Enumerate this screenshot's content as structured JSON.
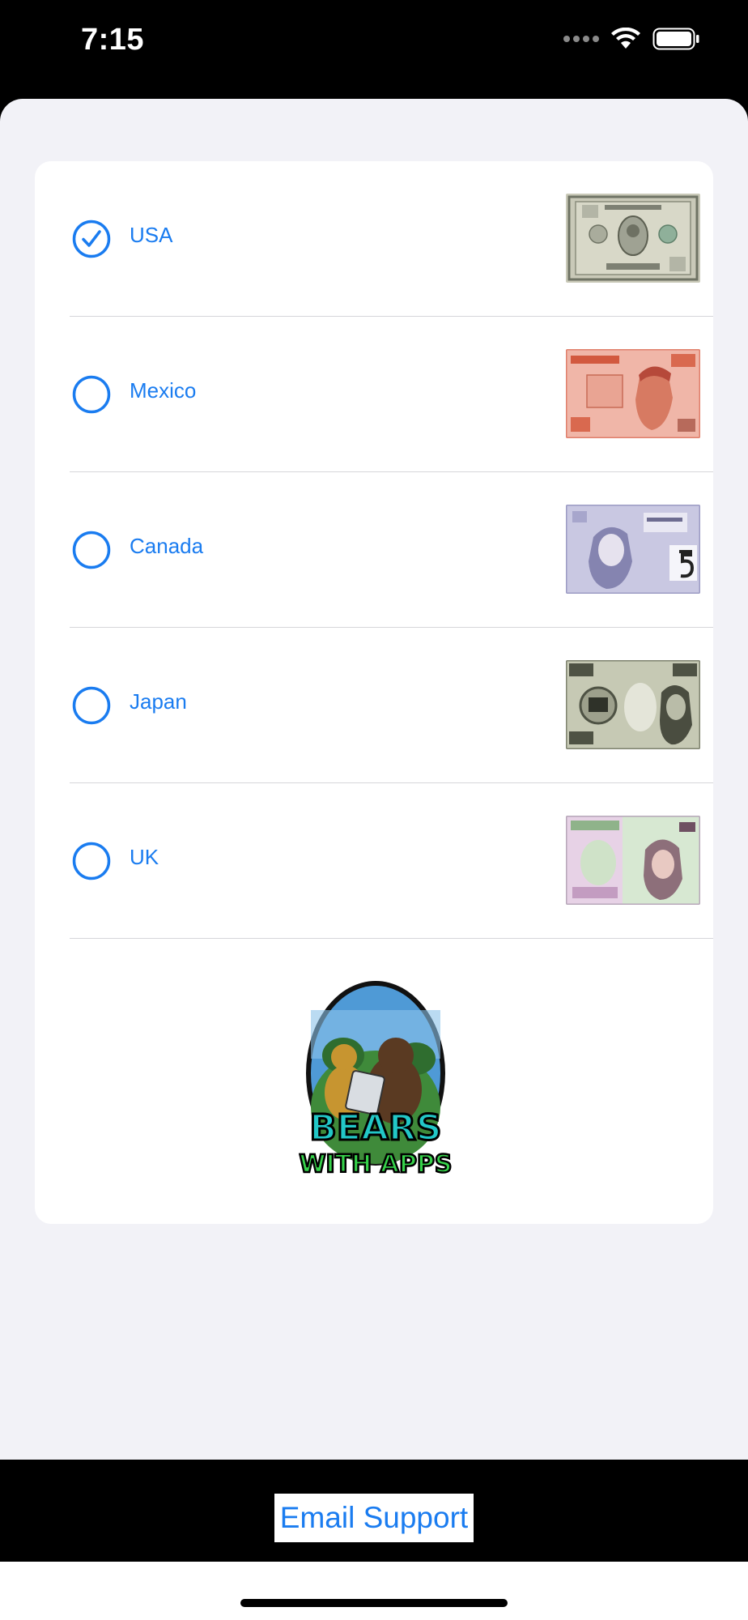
{
  "status_bar": {
    "time": "7:15",
    "icons": [
      "signal-dots-icon",
      "wifi-icon",
      "battery-icon"
    ]
  },
  "currency_options": [
    {
      "label": "USA",
      "selected": true,
      "bill_icon": "us-dollar-bill-image"
    },
    {
      "label": "Mexico",
      "selected": false,
      "bill_icon": "mexican-peso-bill-image"
    },
    {
      "label": "Canada",
      "selected": false,
      "bill_icon": "canadian-dollar-bill-image"
    },
    {
      "label": "Japan",
      "selected": false,
      "bill_icon": "japanese-yen-bill-image"
    },
    {
      "label": "UK",
      "selected": false,
      "bill_icon": "british-pound-bill-image"
    }
  ],
  "logo": {
    "line1": "BEARS",
    "line2": "WITH APPS"
  },
  "footer": {
    "email_support_label": "Email Support"
  },
  "colors": {
    "accent": "#1a7cf0",
    "background": "#f2f2f7",
    "card": "#ffffff"
  }
}
